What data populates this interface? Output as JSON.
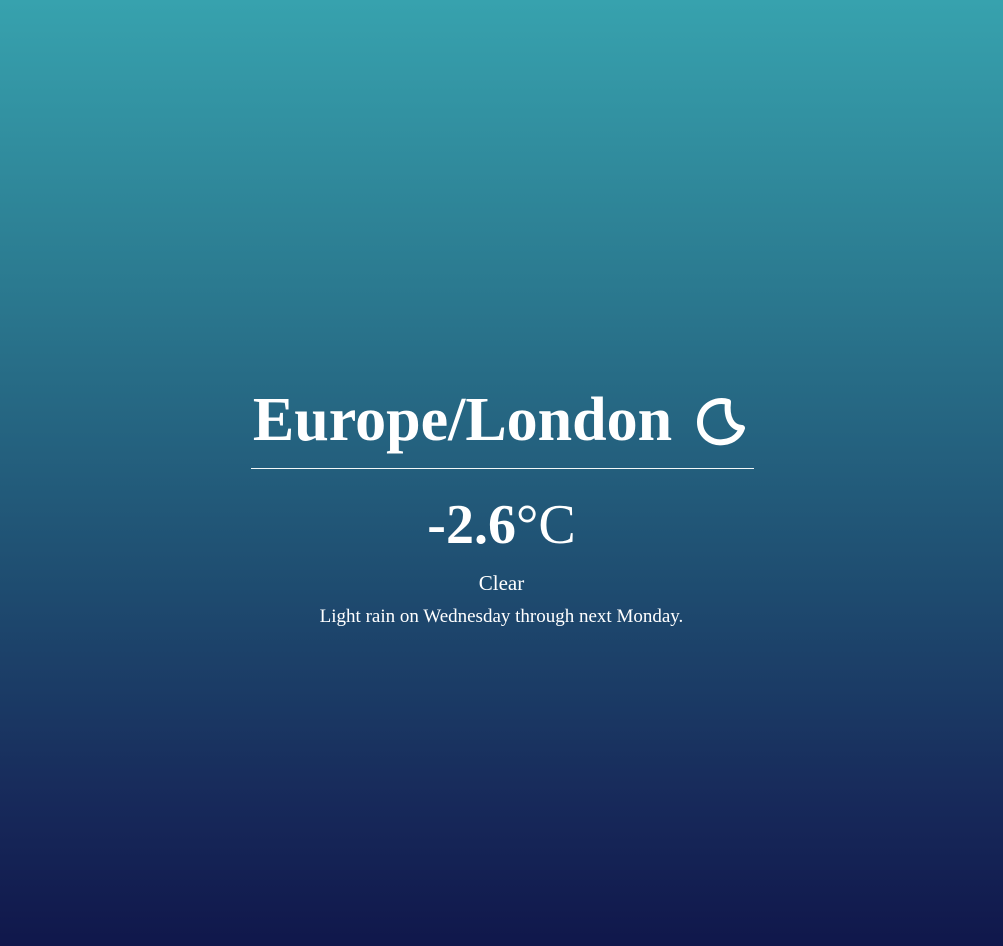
{
  "location": {
    "timezone": "Europe/London",
    "icon": "clear-night-moon-icon"
  },
  "current": {
    "temperature": "-2.6",
    "unit": "°C",
    "summary": "Clear"
  },
  "forecast": {
    "text": "Light rain on Wednesday through next Monday."
  },
  "colors": {
    "gradient_top": "#37a2ae",
    "gradient_bottom": "#10174b",
    "text": "#ffffff"
  }
}
